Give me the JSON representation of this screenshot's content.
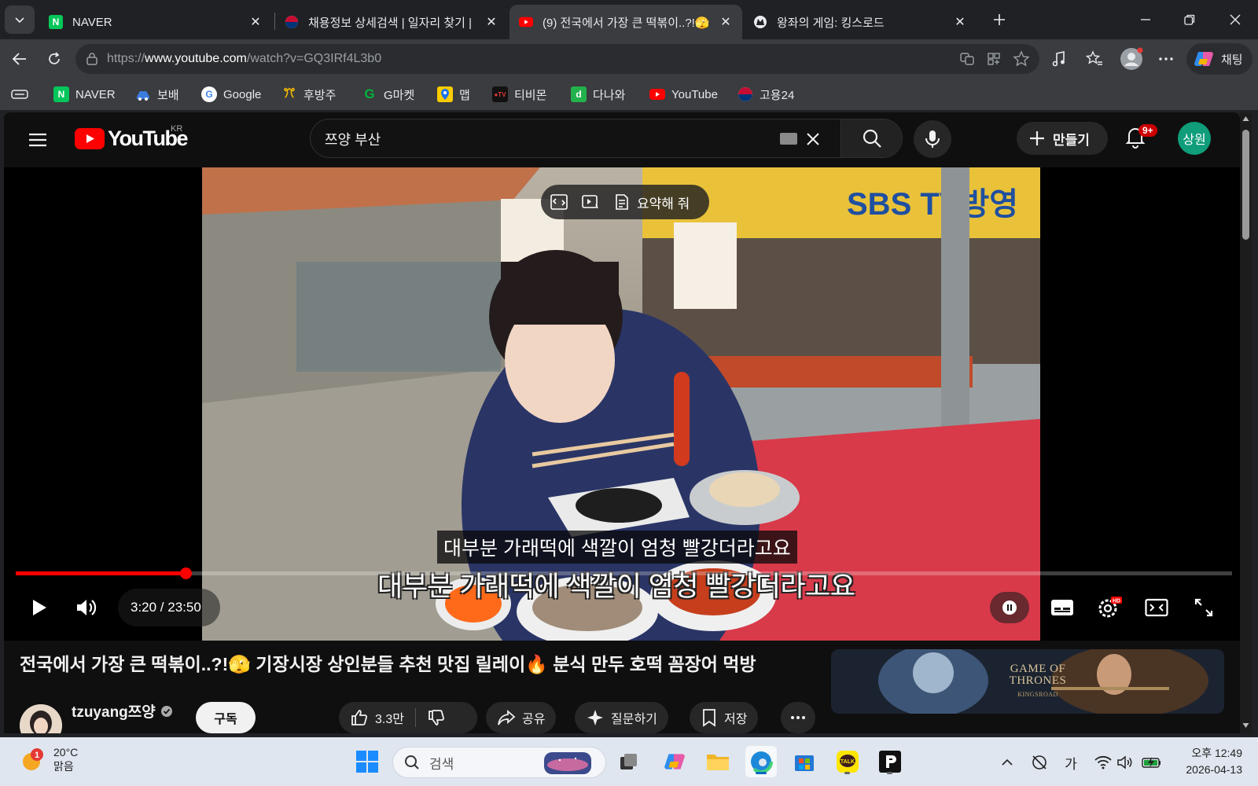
{
  "browser": {
    "tabs": [
      {
        "title": "NAVER",
        "active": false
      },
      {
        "title": "채용정보 상세검색 | 일자리 찾기 |",
        "active": false
      },
      {
        "title": "(9) 전국에서 가장 큰 떡볶이..?!🫣",
        "active": true
      },
      {
        "title": "왕좌의 게임: 킹스로드",
        "active": false
      }
    ],
    "url_prefix": "https://",
    "url_host": "www.youtube.com",
    "url_path": "/watch?v=GQ3IRf4L3b0",
    "chat_label": "채팅",
    "bookmarks": [
      {
        "label": "NAVER",
        "icon": "naver-icon",
        "color": "#03c75a"
      },
      {
        "label": "보배",
        "icon": "bobae-icon",
        "color": "#3b7ddd"
      },
      {
        "label": "Google",
        "icon": "google-icon",
        "color": "#ffffff"
      },
      {
        "label": "후방주",
        "icon": "hubangju-icon",
        "color": "#f2b705"
      },
      {
        "label": "G마켓",
        "icon": "gmarket-icon",
        "color": "#00b33c"
      },
      {
        "label": "맵",
        "icon": "map-icon",
        "color": "#ffcc00"
      },
      {
        "label": "티비몬",
        "icon": "tvmon-icon",
        "color": "#111111"
      },
      {
        "label": "다나와",
        "icon": "danawa-icon",
        "color": "#22b14c"
      },
      {
        "label": "YouTube",
        "icon": "youtube-icon",
        "color": "#ff0000"
      },
      {
        "label": "고용24",
        "icon": "goyong24-icon",
        "color": "#c60c30"
      }
    ]
  },
  "youtube": {
    "logo_text": "YouTube",
    "region": "KR",
    "search_value": "쯔양 부산",
    "create_label": "만들기",
    "notif_badge": "9+",
    "avatar_text": "상원",
    "player": {
      "ai_summary_label": "요약해 줘",
      "subtitle_top": "대부분 가래떡에 색깔이 엄청 빨강더라고요",
      "subtitle_burned": "대부분 가래떡에 색깔이 엄청 빨강더라고요",
      "time_display": "3:20 / 23:50",
      "progress": 0.1399
    },
    "video_title": "전국에서 가장 큰 떡볶이..?!🫣 기장시장 상인분들 추천 맛집 릴레이🔥 분식 만두 호떡 꼼장어 먹방",
    "channel_name": "tzuyang쯔양",
    "subscribe_label": "구독",
    "like_count": "3.3만",
    "share_label": "공유",
    "ask_label": "질문하기",
    "save_label": "저장",
    "ad_title": "GAME OF THRONES",
    "ad_subtitle": "KINGSROAD"
  },
  "taskbar": {
    "weather_temp": "20°C",
    "weather_desc": "맑음",
    "weather_badge": "1",
    "search_placeholder": "검색",
    "ime_label": "가",
    "time": "오후 12:49",
    "date": "2026-04-13"
  }
}
